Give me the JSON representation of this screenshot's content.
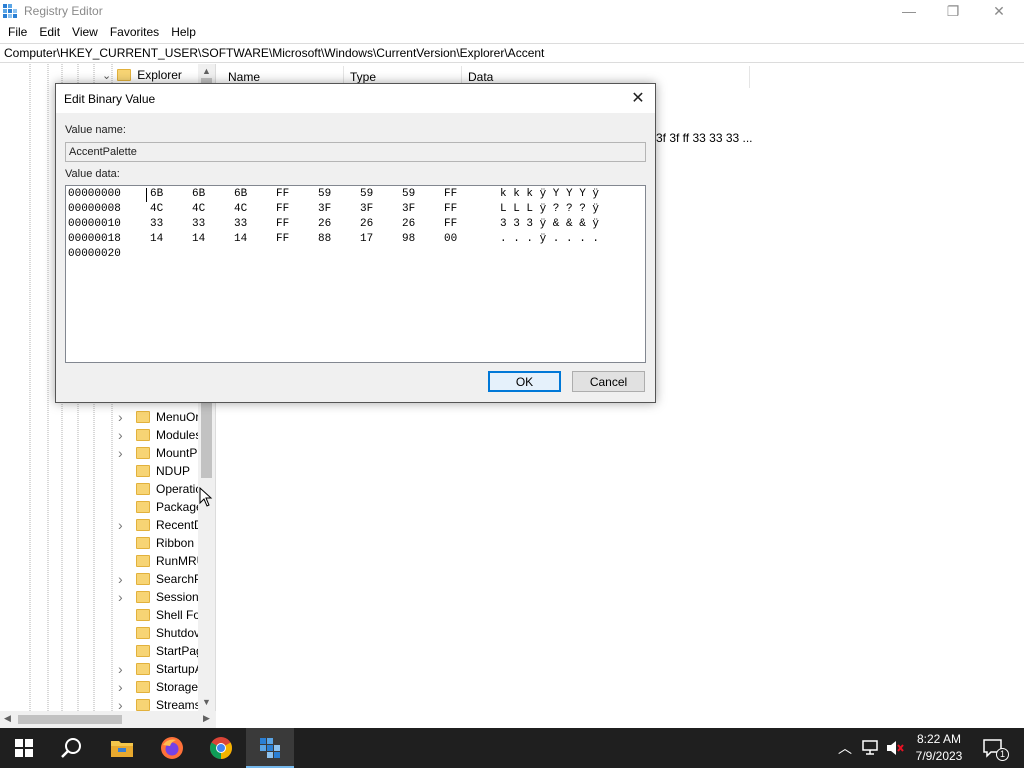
{
  "app": {
    "title": "Registry Editor",
    "minimize_glyph": "—",
    "maximize_glyph": "❐",
    "close_glyph": "✕"
  },
  "menu": [
    "File",
    "Edit",
    "View",
    "Favorites",
    "Help"
  ],
  "address": "Computer\\HKEY_CURRENT_USER\\SOFTWARE\\Microsoft\\Windows\\CurrentVersion\\Explorer\\Accent",
  "tree": {
    "top_item": "Explorer",
    "items": [
      {
        "label": "MenuOr",
        "expandable": true
      },
      {
        "label": "Modules",
        "expandable": true
      },
      {
        "label": "MountP",
        "expandable": true
      },
      {
        "label": "NDUP",
        "expandable": false
      },
      {
        "label": "Operatic",
        "expandable": false
      },
      {
        "label": "Package",
        "expandable": false
      },
      {
        "label": "RecentD",
        "expandable": true
      },
      {
        "label": "Ribbon",
        "expandable": false
      },
      {
        "label": "RunMRU",
        "expandable": false
      },
      {
        "label": "SearchP",
        "expandable": true
      },
      {
        "label": "SessionI",
        "expandable": true
      },
      {
        "label": "Shell Fol",
        "expandable": false
      },
      {
        "label": "Shutdov",
        "expandable": false
      },
      {
        "label": "StartPag",
        "expandable": false
      },
      {
        "label": "StartupA",
        "expandable": true
      },
      {
        "label": "StorageI",
        "expandable": true
      },
      {
        "label": "Streams",
        "expandable": true
      }
    ]
  },
  "list": {
    "columns": [
      "Name",
      "Type",
      "Data"
    ],
    "data_fragment": "3f 3f ff 33 33 33 ..."
  },
  "dialog": {
    "title": "Edit Binary Value",
    "value_name_label": "Value name:",
    "value_name": "AccentPalette",
    "value_data_label": "Value data:",
    "rows": [
      {
        "offset": "00000000",
        "bytes": [
          "6B",
          "6B",
          "6B",
          "FF",
          "59",
          "59",
          "59",
          "FF"
        ],
        "ascii": "k k k ÿ Y Y Y ÿ"
      },
      {
        "offset": "00000008",
        "bytes": [
          "4C",
          "4C",
          "4C",
          "FF",
          "3F",
          "3F",
          "3F",
          "FF"
        ],
        "ascii": "L L L ÿ ? ? ? ÿ"
      },
      {
        "offset": "00000010",
        "bytes": [
          "33",
          "33",
          "33",
          "FF",
          "26",
          "26",
          "26",
          "FF"
        ],
        "ascii": "3 3 3 ÿ & & & ÿ"
      },
      {
        "offset": "00000018",
        "bytes": [
          "14",
          "14",
          "14",
          "FF",
          "88",
          "17",
          "98",
          "00"
        ],
        "ascii": ". . . ÿ . . . ."
      },
      {
        "offset": "00000020",
        "bytes": [],
        "ascii": ""
      }
    ],
    "ok_label": "OK",
    "cancel_label": "Cancel",
    "accent_color": "#0078d7"
  },
  "taskbar": {
    "pinned": [
      "start-icon",
      "search-icon",
      "file-explorer-icon",
      "firefox-icon",
      "chrome-icon",
      "registry-editor-icon"
    ],
    "time": "8:22 AM",
    "date": "7/9/2023",
    "notification_count": "1"
  }
}
